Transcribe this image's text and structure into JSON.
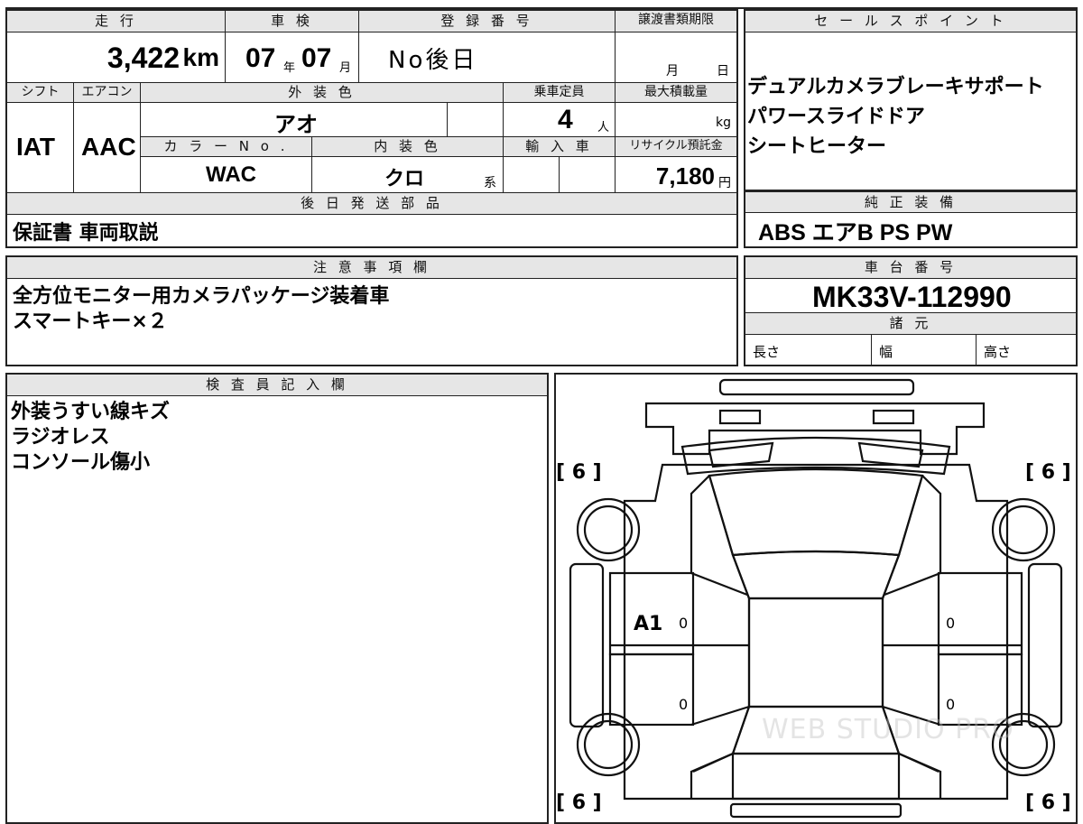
{
  "header": {
    "mileage": "走 行",
    "inspection": "車 検",
    "registration": "登 録 番 号",
    "transfer_deadline": "譲渡書類期限",
    "shift": "シフト",
    "aircon": "エアコン",
    "exterior_color": "外 装 色",
    "capacity": "乗車定員",
    "max_load": "最大積載量",
    "color_no": "カ ラ ー N o .",
    "interior_color": "内 装 色",
    "import_car": "輸 入 車",
    "recycle_fee": "リサイクル預託金",
    "later_items": "後 日 発 送 部 品",
    "sales_points": "セ ー ル ス ポ イ ン ト",
    "standard_equipment": "純 正 装 備",
    "notes": "注 意 事 項 欄",
    "chassis_no": "車 台 番 号",
    "specs": "諸 元",
    "inspector": "検 査 員 記 入 欄"
  },
  "vehicle": {
    "mileage_value": "3,422",
    "mileage_unit": "km",
    "inspection_year": "07",
    "year_char": "年",
    "inspection_month": "07",
    "month_char": "月",
    "registration_no": "No後日",
    "deadline_month": "月",
    "deadline_day": "日",
    "shift_value": "IAT",
    "aircon_value": "AAC",
    "exterior_color_value": "アオ",
    "capacity_value": "4",
    "capacity_unit": "人",
    "max_load_unit": "kg",
    "color_no_value": "WAC",
    "interior_color_value": "クロ",
    "interior_suffix": "系",
    "recycle_value": "7,180",
    "recycle_unit": "円",
    "chassis_no_value": "MK33V-112990",
    "length_label": "長さ",
    "width_label": "幅",
    "height_label": "高さ"
  },
  "later_items_text": "保証書 車両取説",
  "sales_points_text": "デュアルカメラブレーキサポート\nパワースライドドア\nシートヒーター",
  "equipment_text": "ABS エアB PS PW",
  "notes_text": "全方位モニター用カメラパッケージ装着車\nスマートキー×２",
  "inspector_text": "外装うすい線キズ\nラジオレス\nコンソール傷小",
  "diagram": {
    "tire_tl": "[ 6 ]",
    "tire_tr": "[ 6 ]",
    "tire_bl": "[ 6 ]",
    "tire_br": "[ 6 ]",
    "damage_code": "A1",
    "zero": "0",
    "watermark": "WEB STUDIO PRO"
  }
}
